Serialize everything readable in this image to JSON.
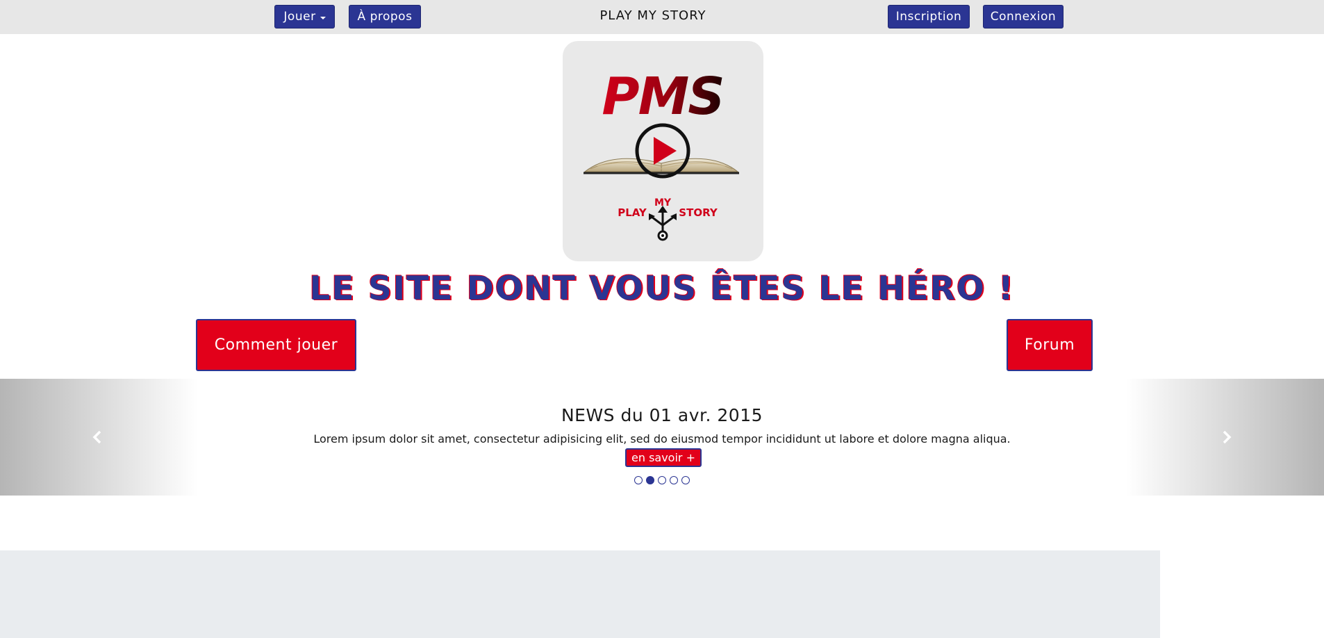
{
  "nav": {
    "play_label": "Jouer",
    "about_label": "À propos",
    "brand": "PLAY MY STORY",
    "signup_label": "Inscription",
    "login_label": "Connexion"
  },
  "logo": {
    "letters": "PMS",
    "line1": "MY",
    "line2_left": "PLAY",
    "line2_right": "STORY"
  },
  "hero": {
    "title": "LE SITE DONT VOUS ÊTES LE HÉRO !",
    "how_to_label": "Comment jouer",
    "forum_label": "Forum"
  },
  "news": {
    "title": "NEWS du 01 avr. 2015",
    "body": "Lorem ipsum dolor sit amet, consectetur adipisicing elit, sed do eiusmod tempor incididunt ut labore et dolore magna aliqua.",
    "more_label": "en savoir +",
    "slide_count": 5,
    "active_slide": 2
  },
  "colors": {
    "primary_blue": "#2b3593",
    "accent_red": "#e2001a",
    "nav_bg": "#e7e7e7",
    "panel_bg": "#e9ecef"
  },
  "icons": {
    "prev": "chevron-left-icon",
    "next": "chevron-right-icon",
    "dropdown": "caret-down-icon",
    "play": "play-icon",
    "book": "open-book-icon",
    "branch": "branch-arrows-icon"
  }
}
